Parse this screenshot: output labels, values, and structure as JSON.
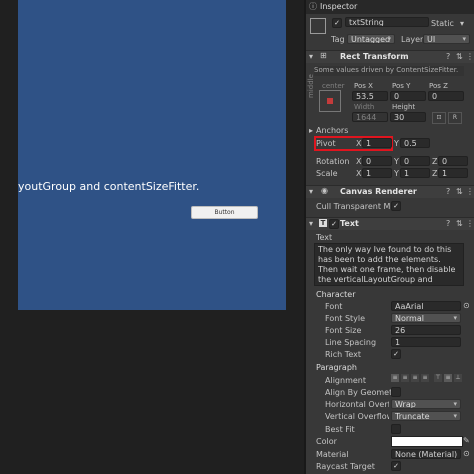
{
  "game": {
    "overflow_text": "youtGroup and contentSizeFitter.",
    "button_label": "Button"
  },
  "inspector": {
    "tab_label": "Inspector",
    "object_name": "txtString",
    "static_label": "Static",
    "tag_label": "Tag",
    "tag_value": "Untagged",
    "layer_label": "Layer",
    "layer_value": "UI"
  },
  "rect_transform": {
    "title": "Rect Transform",
    "note": "Some values driven by ContentSizeFitter.",
    "anchor_preset_top": "center",
    "anchor_preset_side": "middle",
    "pos_x_label": "Pos X",
    "pos_y_label": "Pos Y",
    "pos_z_label": "Pos Z",
    "pos_x": "53.5",
    "pos_y": "0",
    "pos_z": "0",
    "width_label": "Width",
    "height_label": "Height",
    "width": "1644",
    "height": "30",
    "anchors_label": "Anchors",
    "pivot_label": "Pivot",
    "pivot_x_label": "X",
    "pivot_x": "1",
    "pivot_y_label": "Y",
    "pivot_y": "0.5",
    "rotation_label": "Rotation",
    "rot_x": "0",
    "rot_y": "0",
    "rot_z": "0",
    "scale_label": "Scale",
    "scale_x": "1",
    "scale_y": "1",
    "scale_z": "1",
    "axis_x": "X",
    "axis_y": "Y",
    "axis_z": "Z",
    "raw_btn": "R"
  },
  "canvas_renderer": {
    "title": "Canvas Renderer",
    "cull_label": "Cull Transparent Mes"
  },
  "text_component": {
    "title": "Text",
    "text_label": "Text",
    "text_value": "The only way Ive found to do this has been to add the elements. Then wait one frame, then disable the verticalLayoutGroup and contentSizeFitter.",
    "character_label": "Character",
    "font_label": "Font",
    "font_value": "Arial",
    "font_style_label": "Font Style",
    "font_style_value": "Normal",
    "font_size_label": "Font Size",
    "font_size_value": "26",
    "line_spacing_label": "Line Spacing",
    "line_spacing_value": "1",
    "rich_text_label": "Rich Text",
    "paragraph_label": "Paragraph",
    "alignment_label": "Alignment",
    "align_geo_label": "Align By Geometry",
    "h_overflow_label": "Horizontal Overflow",
    "h_overflow_value": "Wrap",
    "v_overflow_label": "Vertical Overflow",
    "v_overflow_value": "Truncate",
    "best_fit_label": "Best Fit",
    "color_label": "Color",
    "material_label": "Material",
    "material_value": "None (Material)",
    "raycast_label": "Raycast Target"
  },
  "colors": {
    "game_canvas": "#2f5286",
    "highlight_box": "#e0141e",
    "inspector_bg": "#383838"
  }
}
